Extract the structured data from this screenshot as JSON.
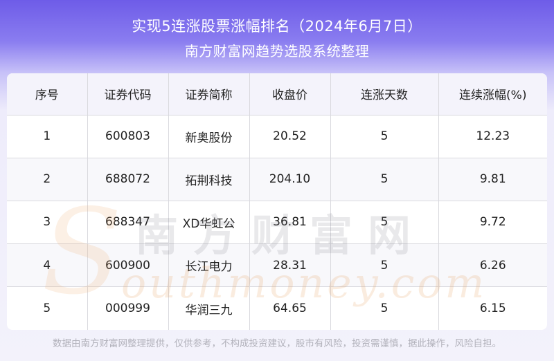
{
  "header": {
    "title": "实现5连涨股票涨幅排名（2024年6月7日）",
    "subtitle": "南方财富网趋势选股系统整理"
  },
  "table": {
    "columns": [
      "序号",
      "证券代码",
      "证券简称",
      "收盘价",
      "连涨天数",
      "连续涨幅(%)"
    ],
    "rows": [
      [
        "1",
        "600803",
        "新奥股份",
        "20.52",
        "5",
        "12.23"
      ],
      [
        "2",
        "688072",
        "拓荆科技",
        "204.10",
        "5",
        "9.81"
      ],
      [
        "3",
        "688347",
        "XD华虹公",
        "36.81",
        "5",
        "9.72"
      ],
      [
        "4",
        "600900",
        "长江电力",
        "28.31",
        "5",
        "6.26"
      ],
      [
        "5",
        "000999",
        "华润三九",
        "64.65",
        "5",
        "6.15"
      ]
    ]
  },
  "watermark": {
    "cn": "南方财富网",
    "en": "outhmoney.com",
    "s": "S"
  },
  "footer": {
    "disclaimer": "数据由南方财富网整理提供，仅供参考，不构成投资建议，股市有风险，投资需谨慎，据此操作，风险自担。"
  }
}
